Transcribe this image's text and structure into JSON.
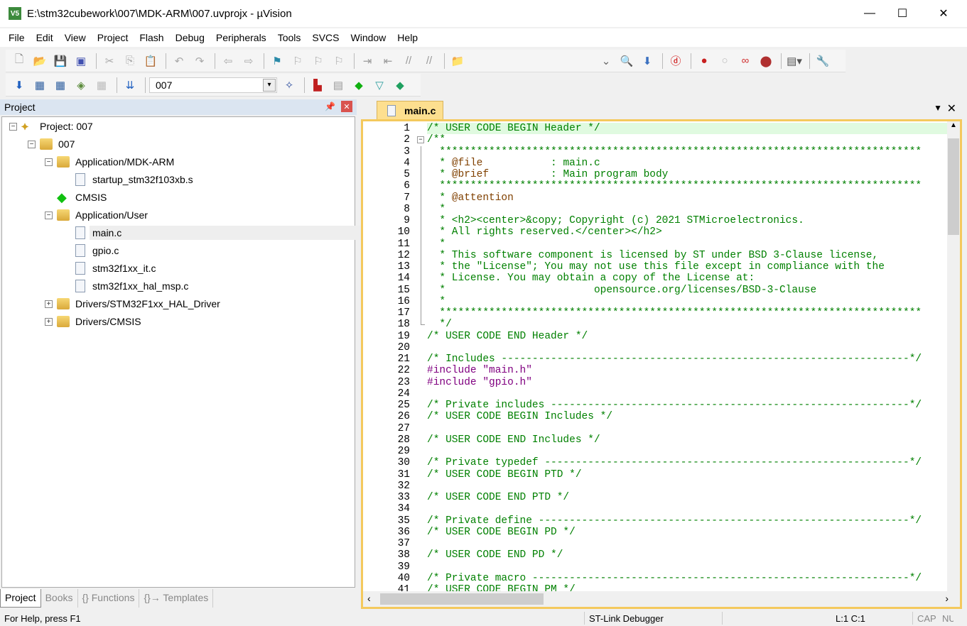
{
  "window": {
    "title": "E:\\stm32cubework\\007\\MDK-ARM\\007.uvprojx - µVision",
    "app_icon": "V5"
  },
  "menu": [
    "File",
    "Edit",
    "View",
    "Project",
    "Flash",
    "Debug",
    "Peripherals",
    "Tools",
    "SVCS",
    "Window",
    "Help"
  ],
  "toolbar1": [
    {
      "icon": "new-file-icon",
      "g": "🗋",
      "c": "#888"
    },
    {
      "icon": "open-folder-icon",
      "g": "📂",
      "c": "#d9a93a"
    },
    {
      "icon": "save-icon",
      "g": "💾",
      "c": "#3040a0"
    },
    {
      "icon": "save-all-icon",
      "g": "▣",
      "c": "#4050b0"
    },
    "|",
    {
      "icon": "cut-icon",
      "g": "✂",
      "c": "#aaa"
    },
    {
      "icon": "copy-icon",
      "g": "⎘",
      "c": "#aaa"
    },
    {
      "icon": "paste-icon",
      "g": "📋",
      "c": "#b08030"
    },
    "|",
    {
      "icon": "undo-icon",
      "g": "↶",
      "c": "#aaa"
    },
    {
      "icon": "redo-icon",
      "g": "↷",
      "c": "#aaa"
    },
    "|",
    {
      "icon": "navigate-back-icon",
      "g": "⇦",
      "c": "#aaa"
    },
    {
      "icon": "navigate-forward-icon",
      "g": "⇨",
      "c": "#aaa"
    },
    "|",
    {
      "icon": "bookmark-icon",
      "g": "⚑",
      "c": "#2a8aa8"
    },
    {
      "icon": "prev-bookmark-icon",
      "g": "⚐",
      "c": "#aaa"
    },
    {
      "icon": "next-bookmark-icon",
      "g": "⚐",
      "c": "#aaa"
    },
    {
      "icon": "clear-bookmarks-icon",
      "g": "⚐",
      "c": "#aaa"
    },
    "|",
    {
      "icon": "indent-icon",
      "g": "⇥",
      "c": "#999"
    },
    {
      "icon": "unindent-icon",
      "g": "⇤",
      "c": "#999"
    },
    {
      "icon": "comment-icon",
      "g": "//",
      "c": "#999"
    },
    {
      "icon": "uncomment-icon",
      "g": "//",
      "c": "#999"
    },
    "|",
    {
      "icon": "find-in-files-icon",
      "g": "📁",
      "c": "#d9a93a"
    }
  ],
  "toolbar1b": [
    {
      "icon": "find-dropdown-icon",
      "g": "⌄",
      "c": "#666"
    },
    {
      "icon": "incremental-find-icon",
      "g": "🔍",
      "c": "#4060b0"
    },
    {
      "icon": "debug-session-icon",
      "g": "⬇",
      "c": "#3a70c0"
    },
    "|",
    {
      "icon": "debug-start-icon",
      "g": "ⓓ",
      "c": "#c00"
    },
    "|",
    {
      "icon": "breakpoint-icon",
      "g": "●",
      "c": "#c82020"
    },
    {
      "icon": "disable-breakpoint-icon",
      "g": "○",
      "c": "#bbb"
    },
    {
      "icon": "disable-all-breakpoints-icon",
      "g": "∞",
      "c": "#d03030"
    },
    {
      "icon": "kill-breakpoints-icon",
      "g": "⬤",
      "c": "#b03030"
    },
    "|",
    {
      "icon": "window-layout-icon",
      "g": "▤▾",
      "c": "#555"
    },
    "|",
    {
      "icon": "configure-icon",
      "g": "🔧",
      "c": "#4a6a8a"
    }
  ],
  "toolbar2": [
    {
      "icon": "build-icon",
      "g": "⬇",
      "c": "#2060c0"
    },
    {
      "icon": "rebuild-icon",
      "g": "▦",
      "c": "#3060a0"
    },
    {
      "icon": "batch-build-icon",
      "g": "▦",
      "c": "#3060a0"
    },
    {
      "icon": "translate-icon",
      "g": "◈",
      "c": "#5a8a3a"
    },
    {
      "icon": "stop-build-icon",
      "g": "▦",
      "c": "#bbb"
    },
    "|",
    {
      "icon": "download-icon",
      "g": "⇊",
      "c": "#2060c0"
    },
    "|"
  ],
  "target": {
    "value": "007"
  },
  "toolbar2b": [
    {
      "icon": "options-for-target-icon",
      "g": "✧",
      "c": "#3050a0"
    },
    "|",
    {
      "icon": "manage-project-items-icon",
      "g": "▙",
      "c": "#c02020"
    },
    {
      "icon": "select-packs-icon",
      "g": "▤",
      "c": "#999"
    },
    {
      "icon": "manage-rte-icon",
      "g": "◆",
      "c": "#10b010"
    },
    {
      "icon": "pack-installer-icon",
      "g": "▽",
      "c": "#30a0a0"
    },
    {
      "icon": "software-packs-icon",
      "g": "◆",
      "c": "#20a060"
    }
  ],
  "project_panel": {
    "title": "Project",
    "tree": [
      {
        "label": "Project: 007",
        "level": 0,
        "exp": "-",
        "icon": "project-icon"
      },
      {
        "label": "007",
        "level": 1,
        "exp": "-",
        "icon": "target-folder-icon"
      },
      {
        "label": "Application/MDK-ARM",
        "level": 2,
        "exp": "-",
        "icon": "folder-open-icon"
      },
      {
        "label": "startup_stm32f103xb.s",
        "level": 3,
        "icon": "file-icon"
      },
      {
        "label": "CMSIS",
        "level": 2,
        "icon": "cmsis-component-icon"
      },
      {
        "label": "Application/User",
        "level": 2,
        "exp": "-",
        "icon": "folder-open-icon"
      },
      {
        "label": "main.c",
        "level": 3,
        "icon": "file-icon",
        "selected": true
      },
      {
        "label": "gpio.c",
        "level": 3,
        "icon": "file-icon"
      },
      {
        "label": "stm32f1xx_it.c",
        "level": 3,
        "icon": "file-icon"
      },
      {
        "label": "stm32f1xx_hal_msp.c",
        "level": 3,
        "icon": "file-icon"
      },
      {
        "label": "Drivers/STM32F1xx_HAL_Driver",
        "level": 2,
        "exp": "+",
        "icon": "folder-closed-icon"
      },
      {
        "label": "Drivers/CMSIS",
        "level": 2,
        "exp": "+",
        "icon": "folder-closed-icon"
      }
    ],
    "tabs": [
      "Project",
      "Books",
      "{} Functions",
      "{}→ Templates"
    ]
  },
  "editor": {
    "tab": "main.c",
    "lines": [
      [
        [
          "cm",
          "/* USER CODE BEGIN Header */"
        ]
      ],
      [
        [
          "cm",
          "/**"
        ]
      ],
      [
        [
          "cm",
          "  ******************************************************************************"
        ]
      ],
      [
        [
          "cm",
          "  * "
        ],
        [
          "tag",
          "@file"
        ],
        [
          "cm",
          "           : main.c"
        ]
      ],
      [
        [
          "cm",
          "  * "
        ],
        [
          "tag",
          "@brief"
        ],
        [
          "cm",
          "          : Main program body"
        ]
      ],
      [
        [
          "cm",
          "  ******************************************************************************"
        ]
      ],
      [
        [
          "cm",
          "  * "
        ],
        [
          "tag",
          "@attention"
        ]
      ],
      [
        [
          "cm",
          "  *"
        ]
      ],
      [
        [
          "cm",
          "  * <h2><center>&copy; Copyright (c) 2021 STMicroelectronics."
        ]
      ],
      [
        [
          "cm",
          "  * All rights reserved.</center></h2>"
        ]
      ],
      [
        [
          "cm",
          "  *"
        ]
      ],
      [
        [
          "cm",
          "  * This software component is licensed by ST under BSD 3-Clause license,"
        ]
      ],
      [
        [
          "cm",
          "  * the \"License\"; You may not use this file except in compliance with the"
        ]
      ],
      [
        [
          "cm",
          "  * License. You may obtain a copy of the License at:"
        ]
      ],
      [
        [
          "cm",
          "  *                        opensource.org/licenses/BSD-3-Clause"
        ]
      ],
      [
        [
          "cm",
          "  *"
        ]
      ],
      [
        [
          "cm",
          "  ******************************************************************************"
        ]
      ],
      [
        [
          "cm",
          "  */"
        ]
      ],
      [
        [
          "cm",
          "/* USER CODE END Header */"
        ]
      ],
      [],
      [
        [
          "cm",
          "/* Includes ------------------------------------------------------------------*/"
        ]
      ],
      [
        [
          "pp",
          "#include "
        ],
        [
          "str",
          "\"main.h\""
        ]
      ],
      [
        [
          "pp",
          "#include "
        ],
        [
          "str",
          "\"gpio.h\""
        ]
      ],
      [],
      [
        [
          "cm",
          "/* Private includes ----------------------------------------------------------*/"
        ]
      ],
      [
        [
          "cm",
          "/* USER CODE BEGIN Includes */"
        ]
      ],
      [],
      [
        [
          "cm",
          "/* USER CODE END Includes */"
        ]
      ],
      [],
      [
        [
          "cm",
          "/* Private typedef -----------------------------------------------------------*/"
        ]
      ],
      [
        [
          "cm",
          "/* USER CODE BEGIN PTD */"
        ]
      ],
      [],
      [
        [
          "cm",
          "/* USER CODE END PTD */"
        ]
      ],
      [],
      [
        [
          "cm",
          "/* Private define ------------------------------------------------------------*/"
        ]
      ],
      [
        [
          "cm",
          "/* USER CODE BEGIN PD */"
        ]
      ],
      [],
      [
        [
          "cm",
          "/* USER CODE END PD */"
        ]
      ],
      [],
      [
        [
          "cm",
          "/* Private macro -------------------------------------------------------------*/"
        ]
      ],
      [
        [
          "cm",
          "/* USER CODE BEGIN PM */"
        ]
      ]
    ]
  },
  "status": {
    "help": "For Help, press F1",
    "debugger": "ST-Link Debugger",
    "position": "L:1 C:1",
    "cap": "CAP",
    "num": "NUM"
  },
  "colors": {
    "comment": "#008000",
    "doc_tag": "#804000",
    "preprocessor": "#800080",
    "tab_active": "#fddf8f",
    "current_line": "#e0fae0"
  }
}
